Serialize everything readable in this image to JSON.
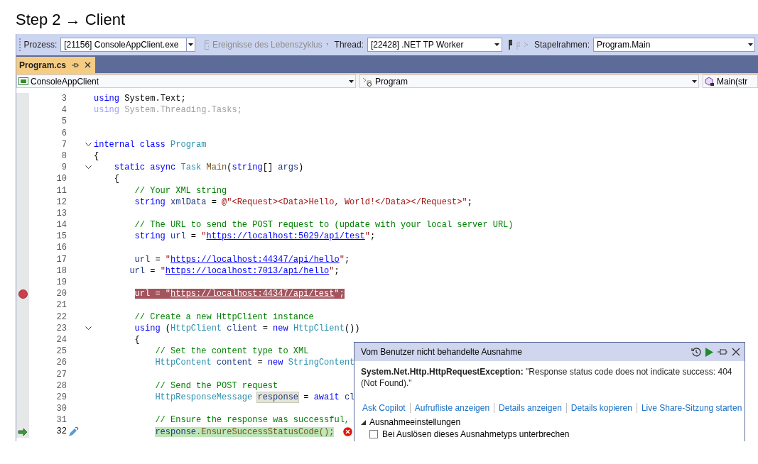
{
  "heading": "Step 2 → Client",
  "toolbar": {
    "process_label": "Prozess:",
    "process": "[21156] ConsoleAppClient.exe",
    "lifecycle": {
      "label": "Ereignisse des Lebenszyklus",
      "disabled": true
    },
    "thread_label": "Thread:",
    "thread": "[22428] .NET TP Worker",
    "stack_label": "Stapelrahmen:",
    "stack": "Program.Main"
  },
  "tabs": [
    {
      "label": "Program.cs",
      "selected": true
    }
  ],
  "nav": {
    "project": "ConsoleAppClient",
    "type": "Program",
    "member": "Main(str"
  },
  "code": {
    "lines": [
      {
        "number": "3",
        "tokens": [
          {
            "text": "using",
            "kind": "kw"
          },
          {
            "text": " System.Text;",
            "kind": "plain"
          }
        ],
        "fold": false,
        "breakpoint": false,
        "current": false,
        "error": false
      },
      {
        "number": "4",
        "tokens": [
          {
            "text": "using",
            "kind": "fadedkw"
          },
          {
            "text": " System.Threading.Tasks;",
            "kind": "faded"
          }
        ],
        "fold": false,
        "breakpoint": false,
        "current": false,
        "error": false
      },
      {
        "number": "5",
        "fold": false,
        "breakpoint": false,
        "current": false,
        "error": false
      },
      {
        "number": "6",
        "fold": false,
        "breakpoint": false,
        "current": false,
        "error": false
      },
      {
        "number": "7",
        "tokens": [
          {
            "text": "internal class",
            "kind": "kw"
          },
          {
            "text": " Program",
            "kind": "type"
          }
        ],
        "fold": true,
        "breakpoint": false,
        "current": false,
        "error": false
      },
      {
        "number": "8",
        "tokens": [
          {
            "text": "{",
            "kind": "plain"
          }
        ],
        "fold": false,
        "breakpoint": false,
        "current": false,
        "error": false
      },
      {
        "number": "9",
        "tokens": [
          {
            "text": "    static async",
            "kind": "kw"
          },
          {
            "text": " Task",
            "kind": "type"
          },
          {
            "text": " Main",
            "kind": "method"
          },
          {
            "text": "(",
            "kind": "plain"
          },
          {
            "text": "string",
            "kind": "kw"
          },
          {
            "text": "[] ",
            "kind": "plain"
          },
          {
            "text": "args",
            "kind": "local"
          },
          {
            "text": ")",
            "kind": "plain"
          }
        ],
        "fold": true,
        "breakpoint": false,
        "current": false,
        "error": false
      },
      {
        "number": "10",
        "tokens": [
          {
            "text": "    {",
            "kind": "plain"
          }
        ],
        "fold": false,
        "breakpoint": false,
        "current": false,
        "error": false
      },
      {
        "number": "11",
        "tokens": [
          {
            "text": "        // Your XML string",
            "kind": "comment"
          }
        ],
        "fold": false,
        "breakpoint": false,
        "current": false,
        "error": false
      },
      {
        "number": "12",
        "tokens": [
          {
            "text": "        string",
            "kind": "kw"
          },
          {
            "text": " xmlData",
            "kind": "local"
          },
          {
            "text": " = ",
            "kind": "plain"
          },
          {
            "text": "@\"<Request><Data>Hello, World!</Data></Request>\"",
            "kind": "str"
          },
          {
            "text": ";",
            "kind": "plain"
          }
        ],
        "fold": false,
        "breakpoint": false,
        "current": false,
        "error": false
      },
      {
        "number": "13",
        "fold": false,
        "breakpoint": false,
        "current": false,
        "error": false
      },
      {
        "number": "14",
        "tokens": [
          {
            "text": "        // The URL to send the POST request to (update with your local server URL)",
            "kind": "comment"
          }
        ],
        "fold": false,
        "breakpoint": false,
        "current": false,
        "error": false
      },
      {
        "number": "15",
        "tokens": [
          {
            "text": "        string",
            "kind": "kw"
          },
          {
            "text": " url",
            "kind": "local"
          },
          {
            "text": " = ",
            "kind": "plain"
          },
          {
            "text": "\"",
            "kind": "str"
          },
          {
            "text": "https://localhost:5029/api/test",
            "kind": "link"
          },
          {
            "text": "\"",
            "kind": "str"
          },
          {
            "text": ";",
            "kind": "plain"
          }
        ],
        "fold": false,
        "breakpoint": false,
        "current": false,
        "error": false
      },
      {
        "number": "16",
        "fold": false,
        "breakpoint": false,
        "current": false,
        "error": false
      },
      {
        "number": "17",
        "tokens": [
          {
            "text": "        url",
            "kind": "local"
          },
          {
            "text": " = ",
            "kind": "plain"
          },
          {
            "text": "\"",
            "kind": "str"
          },
          {
            "text": "https://localhost:44347/api/hello",
            "kind": "link"
          },
          {
            "text": "\"",
            "kind": "str"
          },
          {
            "text": ";",
            "kind": "plain"
          }
        ],
        "fold": false,
        "breakpoint": false,
        "current": false,
        "error": false
      },
      {
        "number": "18",
        "tokens": [
          {
            "text": "       url",
            "kind": "local"
          },
          {
            "text": " = ",
            "kind": "plain"
          },
          {
            "text": "\"",
            "kind": "str"
          },
          {
            "text": "https://localhost:7013/api/hello",
            "kind": "link"
          },
          {
            "text": "\"",
            "kind": "str"
          },
          {
            "text": ";",
            "kind": "plain"
          }
        ],
        "fold": false,
        "breakpoint": false,
        "current": false,
        "error": false
      },
      {
        "number": "19",
        "fold": false,
        "breakpoint": false,
        "current": false,
        "error": false
      },
      {
        "number": "20",
        "tokens": [
          {
            "text": "        url",
            "kind": "local"
          },
          {
            "text": " = ",
            "kind": "plain"
          },
          {
            "text": "\"",
            "kind": "str"
          },
          {
            "text": "https://localhost:44347/api/test",
            "kind": "link"
          },
          {
            "text": "\"",
            "kind": "str"
          },
          {
            "text": ";",
            "kind": "plain"
          }
        ],
        "fold": false,
        "breakpoint": true,
        "current": false,
        "error": false
      },
      {
        "number": "21",
        "fold": false,
        "breakpoint": false,
        "current": false,
        "error": false
      },
      {
        "number": "22",
        "tokens": [
          {
            "text": "        // Create a new HttpClient instance",
            "kind": "comment"
          }
        ],
        "fold": false,
        "breakpoint": false,
        "current": false,
        "error": false
      },
      {
        "number": "23",
        "tokens": [
          {
            "text": "        using",
            "kind": "kw"
          },
          {
            "text": " (",
            "kind": "plain"
          },
          {
            "text": "HttpClient",
            "kind": "type"
          },
          {
            "text": " client",
            "kind": "local"
          },
          {
            "text": " = ",
            "kind": "plain"
          },
          {
            "text": "new",
            "kind": "kw"
          },
          {
            "text": " HttpClient",
            "kind": "type"
          },
          {
            "text": "())",
            "kind": "plain"
          }
        ],
        "fold": true,
        "breakpoint": false,
        "current": false,
        "error": false
      },
      {
        "number": "24",
        "tokens": [
          {
            "text": "        {",
            "kind": "plain"
          }
        ],
        "fold": false,
        "breakpoint": false,
        "current": false,
        "error": false
      },
      {
        "number": "25",
        "tokens": [
          {
            "text": "            // Set the content type to XML",
            "kind": "comment"
          }
        ],
        "fold": false,
        "breakpoint": false,
        "current": false,
        "error": false
      },
      {
        "number": "26",
        "tokens": [
          {
            "text": "            HttpContent",
            "kind": "type"
          },
          {
            "text": " content",
            "kind": "local"
          },
          {
            "text": " = ",
            "kind": "plain"
          },
          {
            "text": "new",
            "kind": "kw"
          },
          {
            "text": " StringContent",
            "kind": "type"
          }
        ],
        "fold": false,
        "breakpoint": false,
        "current": false,
        "error": false
      },
      {
        "number": "27",
        "fold": false,
        "breakpoint": false,
        "current": false,
        "error": false
      },
      {
        "number": "28",
        "tokens": [
          {
            "text": "            // Send the POST request",
            "kind": "comment"
          }
        ],
        "fold": false,
        "breakpoint": false,
        "current": false,
        "error": false
      },
      {
        "number": "29",
        "tokens": [
          {
            "text": "            HttpResponseMessage ",
            "kind": "type"
          },
          {
            "text": "response",
            "kind": "ref"
          },
          {
            "text": " = ",
            "kind": "plain"
          },
          {
            "text": "await",
            "kind": "kw"
          },
          {
            "text": " cl",
            "kind": "local"
          }
        ],
        "fold": false,
        "breakpoint": false,
        "current": false,
        "error": false
      },
      {
        "number": "30",
        "fold": false,
        "breakpoint": false,
        "current": false,
        "error": false
      },
      {
        "number": "31",
        "tokens": [
          {
            "text": "            // Ensure the response was successful,",
            "kind": "comment"
          }
        ],
        "fold": false,
        "breakpoint": false,
        "current": false,
        "error": false
      },
      {
        "number": "32",
        "tokens": [
          {
            "text": "            response",
            "kind": "local"
          },
          {
            "text": ".EnsureSuccessStatusCode();",
            "kind": "method"
          }
        ],
        "fold": false,
        "breakpoint": false,
        "current": true,
        "error": true
      }
    ]
  },
  "exception": {
    "title": "Vom Benutzer nicht behandelte Ausnahme",
    "message": "**System.Net.Http.HttpRequestException:** \"Response status code does not indicate success: 404 (Not Found).\"",
    "actions": [
      "Ask Copilot",
      "Aufrufliste anzeigen",
      "Details anzeigen",
      "Details kopieren",
      "Live Share-Sitzung starten"
    ],
    "settings": {
      "label": "Ausnahmeeinstellungen",
      "expanded": true
    },
    "options": [
      {
        "label": "Bei Auslösen dieses Ausnahmetyps unterbrechen",
        "checked": false
      }
    ]
  }
}
